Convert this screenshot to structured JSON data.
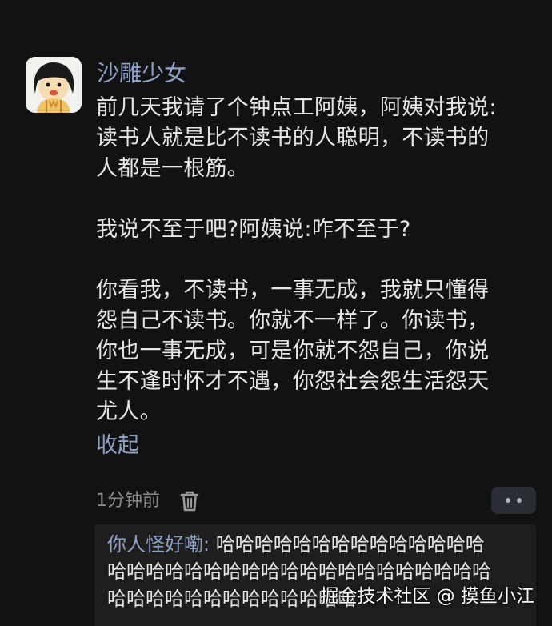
{
  "comment": {
    "author": "沙雕少女",
    "avatar_icon": "cartoon-girl-avatar",
    "paragraphs": [
      {
        "lines": [
          "前几天我请了个钟点工阿姨，阿姨对我说:",
          "读书人就是比不读书的人聪明，不读书的",
          "人都是一根筋。"
        ]
      },
      {
        "lines": [
          "我说不至于吧?阿姨说:咋不至于?"
        ]
      },
      {
        "lines": [
          "你看我，不读书，一事无成，我就只懂得",
          "怨自己不读书。你就不一样了。你读书，",
          "你也一事无成，可是你就不怨自己，你说",
          "生不逢时怀才不遇，你怨社会怨生活怨天",
          "尤人。"
        ]
      }
    ],
    "collapse_label": "收起",
    "timestamp": "1分钟前",
    "delete_icon": "trash-icon",
    "more_icon": "more-dots-icon"
  },
  "reply": {
    "author": "你人怪好嘞:",
    "first_line_text": " 哈哈哈哈哈哈哈哈哈哈哈哈哈哈",
    "line2": "哈哈哈哈哈哈哈哈哈哈哈哈哈哈哈哈哈哈哈哈",
    "line3": "哈哈哈哈哈哈哈哈哈哈哈哈哈"
  },
  "watermark": "掘金技术社区 @ 摸鱼小江",
  "colors": {
    "background": "#121212",
    "link_blue": "#8da2c8",
    "text": "#e6e6e6",
    "muted": "#8a8a8a",
    "reply_bg": "#1e1e1e"
  }
}
